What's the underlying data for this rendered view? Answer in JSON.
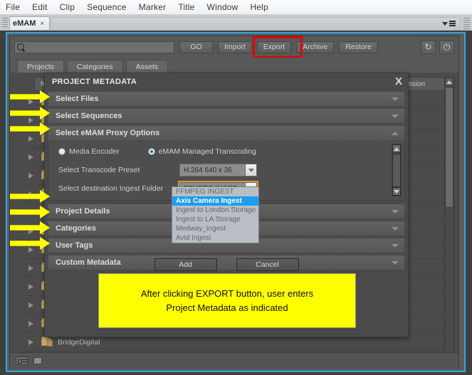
{
  "menubar": {
    "items": [
      "File",
      "Edit",
      "Clip",
      "Sequence",
      "Marker",
      "Title",
      "Window",
      "Help"
    ]
  },
  "tabstrip": {
    "tab_label": "eMAM",
    "tab_close": "×",
    "panel_menu_icon": "panel-menu-icon"
  },
  "toolbar": {
    "search_placeholder": "",
    "search_value": "",
    "search_icon": "search-icon",
    "buttons": [
      "GO",
      "Import",
      "Export",
      "Archive",
      "Restore"
    ],
    "refresh_icon": "↻",
    "power_icon": "⏻",
    "highlight_color": "#e40000"
  },
  "subtabs": {
    "items": [
      "Projects",
      "Categories",
      "Assets"
    ],
    "active": "Projects"
  },
  "tree": {
    "columns": [
      "Name",
      "nsion"
    ],
    "rows": [
      {
        "label": "",
        "type": "folder"
      },
      {
        "label": "",
        "type": "folder"
      },
      {
        "label": "",
        "type": "folder"
      },
      {
        "label": "",
        "type": "folder"
      },
      {
        "label": "",
        "type": "folder"
      },
      {
        "label": "",
        "type": "folder"
      },
      {
        "label": "",
        "type": "folder"
      },
      {
        "label": "",
        "type": "folder"
      },
      {
        "label": "",
        "type": "folder"
      },
      {
        "label": "",
        "type": "folder"
      },
      {
        "label": "",
        "type": "folder"
      },
      {
        "label": "",
        "type": "folder"
      },
      {
        "label": "",
        "type": "folder"
      },
      {
        "label": "BridgeDigital",
        "type": "folder-open"
      }
    ]
  },
  "dialog": {
    "title": "PROJECT METADATA",
    "close_label": "X",
    "sections": [
      {
        "label": "Select Files",
        "state": "collapsed"
      },
      {
        "label": "Select Sequences",
        "state": "collapsed"
      },
      {
        "label": "Select eMAM Proxy Options",
        "state": "expanded"
      }
    ],
    "proxy": {
      "radio_media_encoder": "Media Encoder",
      "radio_emam": "eMAM Managed Transcoding",
      "selected_radio": "eMAM Managed Transcoding",
      "transcode_label": "Select Transcode Preset",
      "transcode_value": "H.264 640 x 36",
      "ingest_label": "Select destination Ingest Folder",
      "ingest_value": "FFMPEG INGES"
    },
    "dropdown": {
      "options": [
        "FFMPEG INGEST",
        "Axis Camera Ingest",
        "Ingest to London Storage",
        "Ingest to LA Storage",
        "Medway_Ingest",
        "Avid Ingest"
      ],
      "selected": "Axis Camera Ingest",
      "highlight_color": "#1b9ef0"
    },
    "lower_sections": [
      {
        "label": "Project Details",
        "state": "collapsed"
      },
      {
        "label": "Categories",
        "state": "collapsed"
      },
      {
        "label": "User Tags",
        "state": "collapsed"
      },
      {
        "label": "Custom Metadata",
        "state": "collapsed"
      }
    ],
    "buttons": {
      "add": "Add",
      "cancel": "Cancel"
    },
    "callout": {
      "line1": "After clicking EXPORT button, user enters",
      "line2": "Project Metadata as indicated",
      "background": "#ffff00"
    }
  },
  "annotation_arrows": {
    "color": "#ffff00",
    "targets": [
      "Select Files",
      "Select Sequences",
      "Select eMAM Proxy Options",
      "Project Details",
      "Categories",
      "User Tags",
      "Custom Metadata"
    ]
  }
}
